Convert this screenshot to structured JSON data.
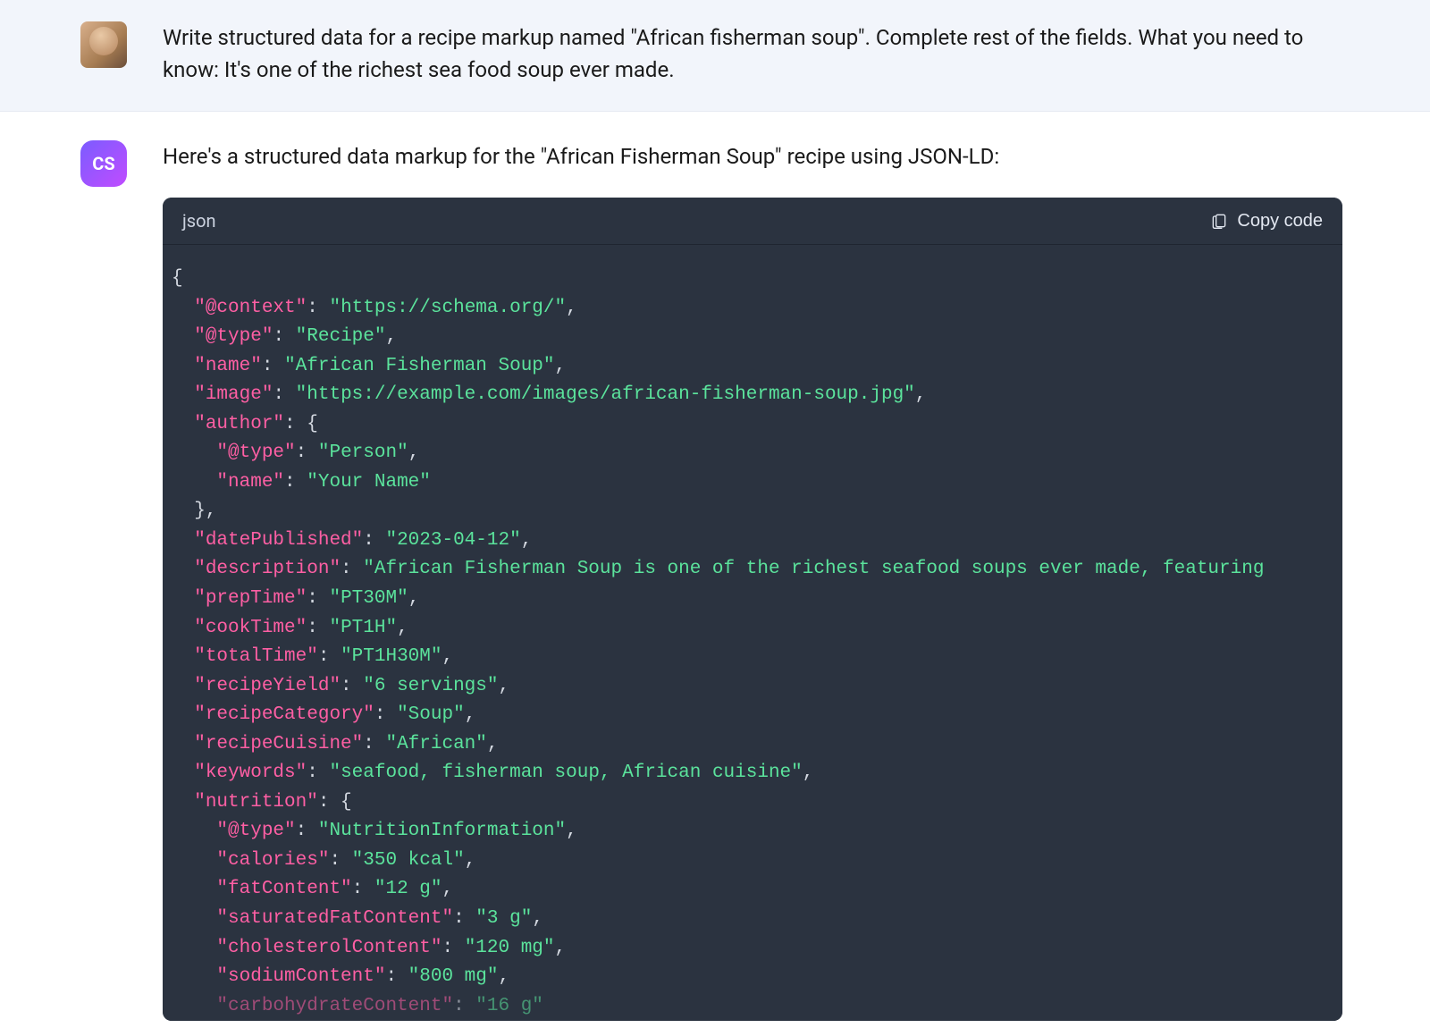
{
  "user": {
    "avatar_alt": "User avatar",
    "message": "Write structured data for a recipe markup named \"African fisherman soup\". Complete rest of the fields. What you need to know: It's one of the richest sea food soup ever made."
  },
  "assistant": {
    "avatar_text": "CS",
    "intro": "Here's a structured data markup for the \"African Fisherman Soup\" recipe using JSON-LD:"
  },
  "code": {
    "language": "json",
    "copy_label": "Copy code",
    "lines": [
      [
        [
          "punct",
          "{"
        ]
      ],
      [
        [
          "punct",
          "  "
        ],
        [
          "key",
          "\"@context\""
        ],
        [
          "punct",
          ": "
        ],
        [
          "str",
          "\"https://schema.org/\""
        ],
        [
          "punct",
          ","
        ]
      ],
      [
        [
          "punct",
          "  "
        ],
        [
          "key",
          "\"@type\""
        ],
        [
          "punct",
          ": "
        ],
        [
          "str",
          "\"Recipe\""
        ],
        [
          "punct",
          ","
        ]
      ],
      [
        [
          "punct",
          "  "
        ],
        [
          "key",
          "\"name\""
        ],
        [
          "punct",
          ": "
        ],
        [
          "str",
          "\"African Fisherman Soup\""
        ],
        [
          "punct",
          ","
        ]
      ],
      [
        [
          "punct",
          "  "
        ],
        [
          "key",
          "\"image\""
        ],
        [
          "punct",
          ": "
        ],
        [
          "str",
          "\"https://example.com/images/african-fisherman-soup.jpg\""
        ],
        [
          "punct",
          ","
        ]
      ],
      [
        [
          "punct",
          "  "
        ],
        [
          "key",
          "\"author\""
        ],
        [
          "punct",
          ": {"
        ]
      ],
      [
        [
          "punct",
          "    "
        ],
        [
          "key",
          "\"@type\""
        ],
        [
          "punct",
          ": "
        ],
        [
          "str",
          "\"Person\""
        ],
        [
          "punct",
          ","
        ]
      ],
      [
        [
          "punct",
          "    "
        ],
        [
          "key",
          "\"name\""
        ],
        [
          "punct",
          ": "
        ],
        [
          "str",
          "\"Your Name\""
        ]
      ],
      [
        [
          "punct",
          "  },"
        ]
      ],
      [
        [
          "punct",
          "  "
        ],
        [
          "key",
          "\"datePublished\""
        ],
        [
          "punct",
          ": "
        ],
        [
          "str",
          "\"2023-04-12\""
        ],
        [
          "punct",
          ","
        ]
      ],
      [
        [
          "punct",
          "  "
        ],
        [
          "key",
          "\"description\""
        ],
        [
          "punct",
          ": "
        ],
        [
          "str",
          "\"African Fisherman Soup is one of the richest seafood soups ever made, featuring"
        ]
      ],
      [
        [
          "punct",
          "  "
        ],
        [
          "key",
          "\"prepTime\""
        ],
        [
          "punct",
          ": "
        ],
        [
          "str",
          "\"PT30M\""
        ],
        [
          "punct",
          ","
        ]
      ],
      [
        [
          "punct",
          "  "
        ],
        [
          "key",
          "\"cookTime\""
        ],
        [
          "punct",
          ": "
        ],
        [
          "str",
          "\"PT1H\""
        ],
        [
          "punct",
          ","
        ]
      ],
      [
        [
          "punct",
          "  "
        ],
        [
          "key",
          "\"totalTime\""
        ],
        [
          "punct",
          ": "
        ],
        [
          "str",
          "\"PT1H30M\""
        ],
        [
          "punct",
          ","
        ]
      ],
      [
        [
          "punct",
          "  "
        ],
        [
          "key",
          "\"recipeYield\""
        ],
        [
          "punct",
          ": "
        ],
        [
          "str",
          "\"6 servings\""
        ],
        [
          "punct",
          ","
        ]
      ],
      [
        [
          "punct",
          "  "
        ],
        [
          "key",
          "\"recipeCategory\""
        ],
        [
          "punct",
          ": "
        ],
        [
          "str",
          "\"Soup\""
        ],
        [
          "punct",
          ","
        ]
      ],
      [
        [
          "punct",
          "  "
        ],
        [
          "key",
          "\"recipeCuisine\""
        ],
        [
          "punct",
          ": "
        ],
        [
          "str",
          "\"African\""
        ],
        [
          "punct",
          ","
        ]
      ],
      [
        [
          "punct",
          "  "
        ],
        [
          "key",
          "\"keywords\""
        ],
        [
          "punct",
          ": "
        ],
        [
          "str",
          "\"seafood, fisherman soup, African cuisine\""
        ],
        [
          "punct",
          ","
        ]
      ],
      [
        [
          "punct",
          "  "
        ],
        [
          "key",
          "\"nutrition\""
        ],
        [
          "punct",
          ": {"
        ]
      ],
      [
        [
          "punct",
          "    "
        ],
        [
          "key",
          "\"@type\""
        ],
        [
          "punct",
          ": "
        ],
        [
          "str",
          "\"NutritionInformation\""
        ],
        [
          "punct",
          ","
        ]
      ],
      [
        [
          "punct",
          "    "
        ],
        [
          "key",
          "\"calories\""
        ],
        [
          "punct",
          ": "
        ],
        [
          "str",
          "\"350 kcal\""
        ],
        [
          "punct",
          ","
        ]
      ],
      [
        [
          "punct",
          "    "
        ],
        [
          "key",
          "\"fatContent\""
        ],
        [
          "punct",
          ": "
        ],
        [
          "str",
          "\"12 g\""
        ],
        [
          "punct",
          ","
        ]
      ],
      [
        [
          "punct",
          "    "
        ],
        [
          "key",
          "\"saturatedFatContent\""
        ],
        [
          "punct",
          ": "
        ],
        [
          "str",
          "\"3 g\""
        ],
        [
          "punct",
          ","
        ]
      ],
      [
        [
          "punct",
          "    "
        ],
        [
          "key",
          "\"cholesterolContent\""
        ],
        [
          "punct",
          ": "
        ],
        [
          "str",
          "\"120 mg\""
        ],
        [
          "punct",
          ","
        ]
      ],
      [
        [
          "punct",
          "    "
        ],
        [
          "key",
          "\"sodiumContent\""
        ],
        [
          "punct",
          ": "
        ],
        [
          "str",
          "\"800 mg\""
        ],
        [
          "punct",
          ","
        ]
      ],
      [
        [
          "punct",
          "    "
        ],
        [
          "key",
          "\"carbohydrateContent\""
        ],
        [
          "punct",
          ": "
        ],
        [
          "str",
          "\"16 g\""
        ]
      ]
    ]
  }
}
